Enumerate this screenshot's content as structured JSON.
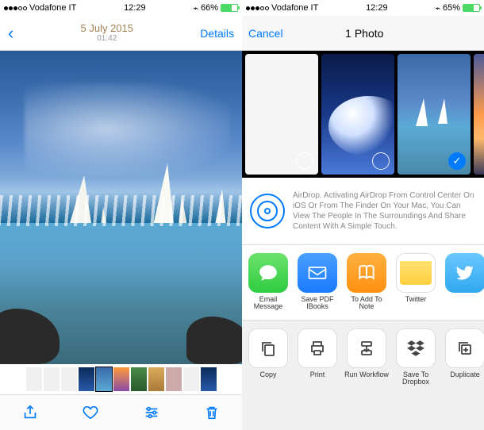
{
  "left": {
    "status": {
      "carrier": "Vodafone IT",
      "time": "12:29",
      "battery": "66%"
    },
    "nav": {
      "title_main": "5 July 2015",
      "title_sub": "01:42",
      "details": "Details"
    }
  },
  "right": {
    "status": {
      "carrier": "Vodafone IT",
      "time": "12:29",
      "battery": "65%"
    },
    "nav": {
      "cancel": "Cancel",
      "count": "1 Photo"
    },
    "airdrop_text": "AirDrop. Activating AirDrop From Control Center On iOS Or From The Finder On Your Mac, You Can View The People In The Surroundings And Share Content With A Simple Touch.",
    "share": {
      "message": "Email Message",
      "ibooks": "Save PDF IBooks",
      "notes": "To Add To Note",
      "twitter": "Twitter"
    },
    "actions": {
      "copy": "Copy",
      "print": "Print",
      "workflow": "Run Workflow",
      "dropbox": "Save To Dropbox",
      "duplicate": "Duplicate"
    }
  }
}
